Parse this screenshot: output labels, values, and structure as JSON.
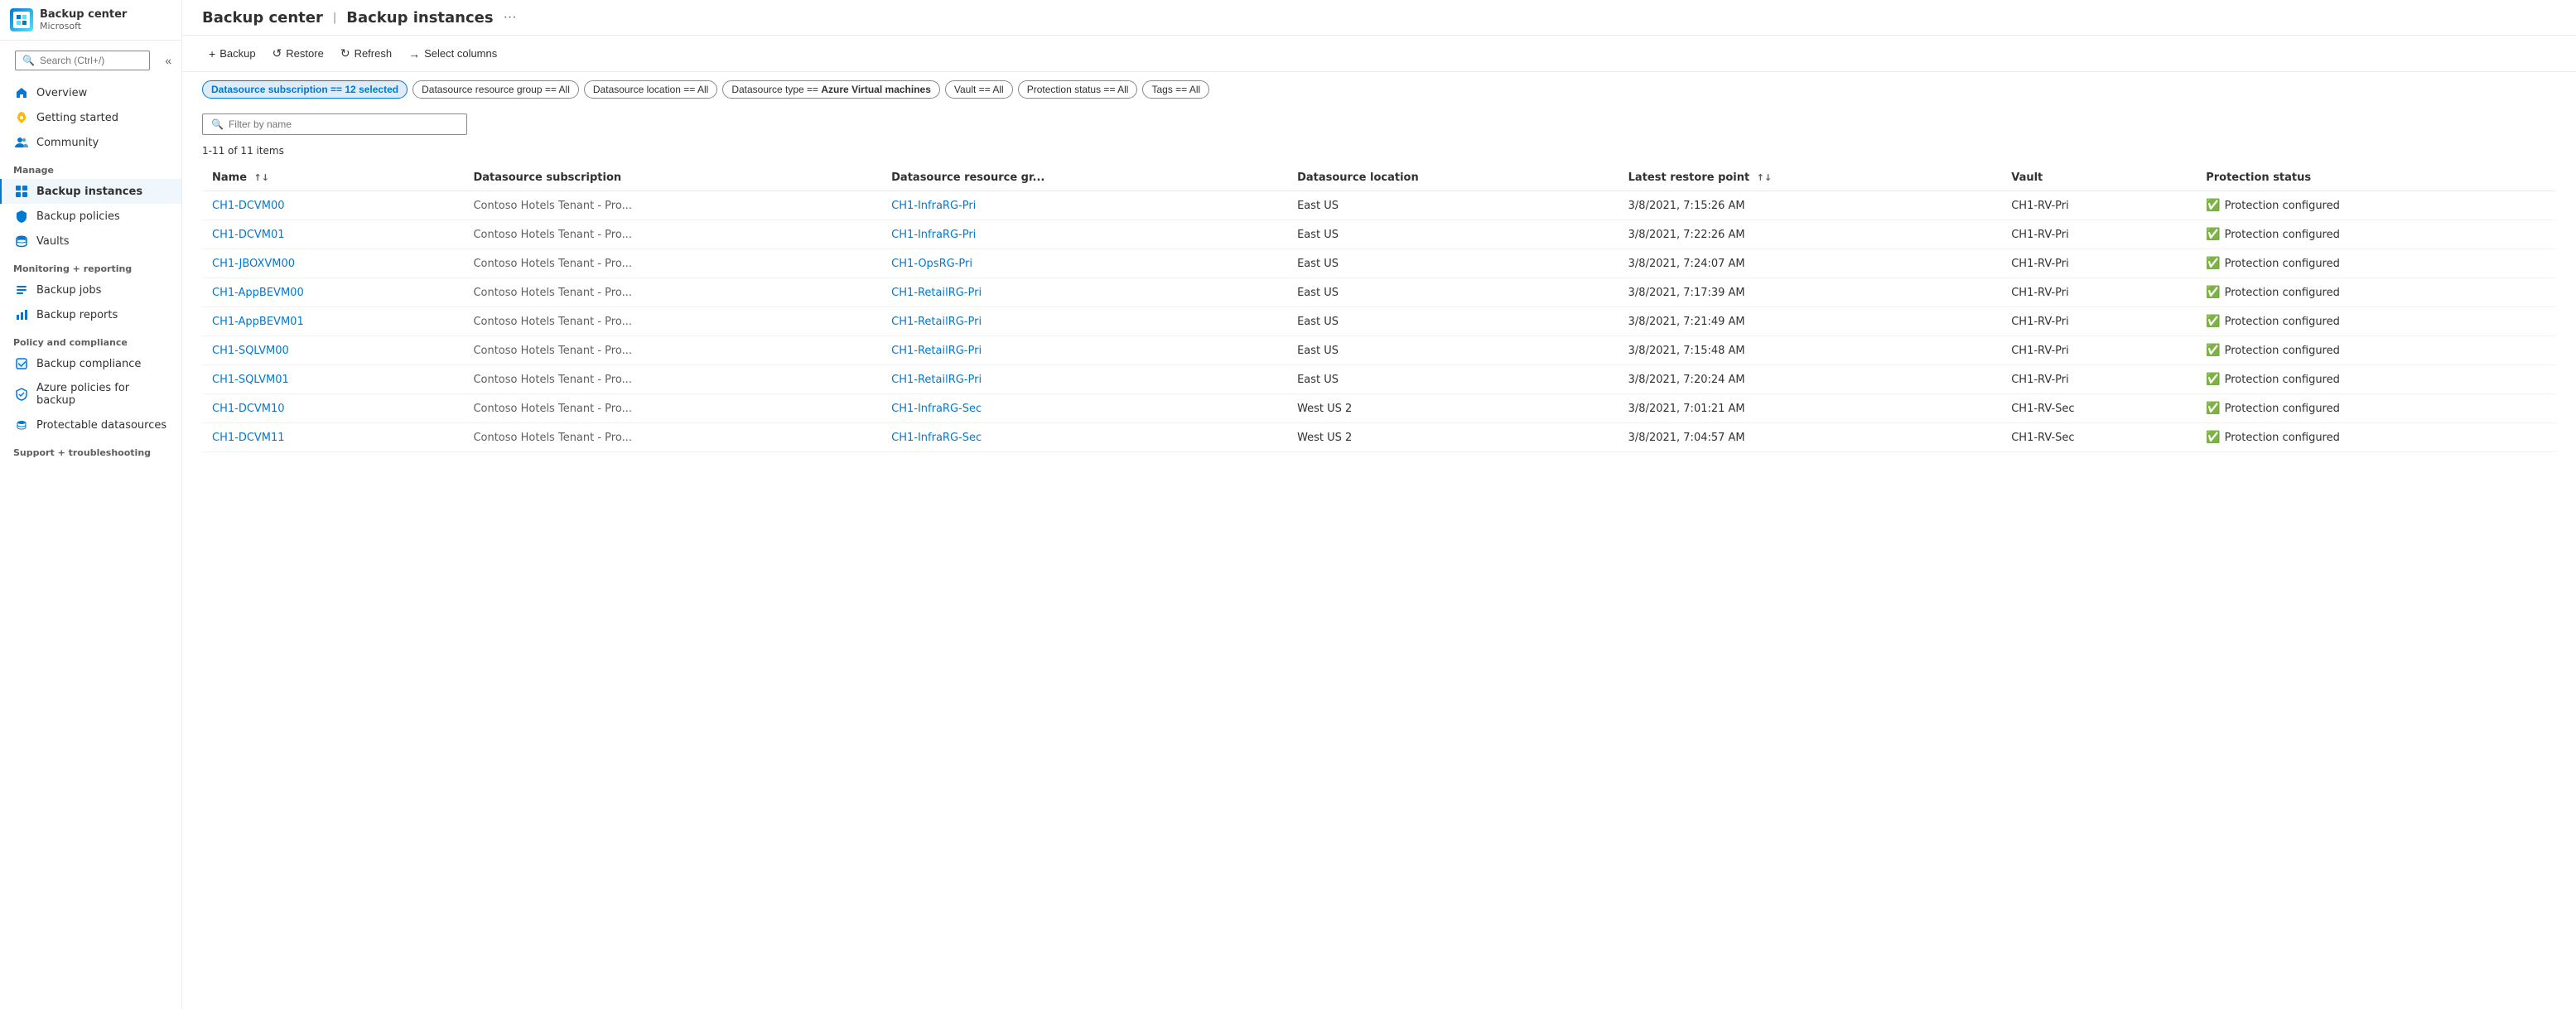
{
  "app": {
    "title": "Backup center",
    "subtitle": "Microsoft",
    "page": "Backup instances"
  },
  "sidebar": {
    "search_placeholder": "Search (Ctrl+/)",
    "nav_items": [
      {
        "id": "overview",
        "label": "Overview",
        "icon": "home"
      },
      {
        "id": "getting-started",
        "label": "Getting started",
        "icon": "rocket"
      },
      {
        "id": "community",
        "label": "Community",
        "icon": "people"
      }
    ],
    "sections": [
      {
        "label": "Manage",
        "items": [
          {
            "id": "backup-instances",
            "label": "Backup instances",
            "icon": "grid",
            "active": true
          },
          {
            "id": "backup-policies",
            "label": "Backup policies",
            "icon": "shield"
          },
          {
            "id": "vaults",
            "label": "Vaults",
            "icon": "database"
          }
        ]
      },
      {
        "label": "Monitoring + reporting",
        "items": [
          {
            "id": "backup-jobs",
            "label": "Backup jobs",
            "icon": "list"
          },
          {
            "id": "backup-reports",
            "label": "Backup reports",
            "icon": "chart"
          }
        ]
      },
      {
        "label": "Policy and compliance",
        "items": [
          {
            "id": "backup-compliance",
            "label": "Backup compliance",
            "icon": "check"
          },
          {
            "id": "azure-policies",
            "label": "Azure policies for backup",
            "icon": "policy"
          },
          {
            "id": "protectable-datasources",
            "label": "Protectable datasources",
            "icon": "data"
          }
        ]
      },
      {
        "label": "Support + troubleshooting",
        "items": []
      }
    ]
  },
  "toolbar": {
    "backup_label": "+ Backup",
    "restore_label": "Restore",
    "refresh_label": "Refresh",
    "select_columns_label": "Select columns"
  },
  "filters": [
    {
      "id": "datasource-sub",
      "label": "Datasource subscription == 12 selected",
      "active": true
    },
    {
      "id": "datasource-rg",
      "label": "Datasource resource group == All",
      "active": false
    },
    {
      "id": "datasource-location",
      "label": "Datasource location == All",
      "active": false
    },
    {
      "id": "datasource-type",
      "label": "Datasource type == Azure Virtual machines",
      "active": false
    },
    {
      "id": "vault",
      "label": "Vault == All",
      "active": false
    },
    {
      "id": "protection-status",
      "label": "Protection status == All",
      "active": false
    },
    {
      "id": "tags",
      "label": "Tags == All",
      "active": false
    }
  ],
  "filter_placeholder": "Filter by name",
  "items_count": "1-11 of 11 items",
  "table": {
    "columns": [
      {
        "id": "name",
        "label": "Name",
        "sortable": true
      },
      {
        "id": "datasource-sub",
        "label": "Datasource subscription",
        "sortable": false
      },
      {
        "id": "datasource-rg",
        "label": "Datasource resource gr...",
        "sortable": false
      },
      {
        "id": "datasource-loc",
        "label": "Datasource location",
        "sortable": false
      },
      {
        "id": "latest-restore",
        "label": "Latest restore point",
        "sortable": true
      },
      {
        "id": "vault",
        "label": "Vault",
        "sortable": false
      },
      {
        "id": "protection-status",
        "label": "Protection status",
        "sortable": false
      }
    ],
    "rows": [
      {
        "name": "CH1-DCVM00",
        "datasource_sub": "Contoso Hotels Tenant - Pro...",
        "datasource_rg": "CH1-InfraRG-Pri",
        "datasource_loc": "East US",
        "latest_restore": "3/8/2021, 7:15:26 AM",
        "vault": "CH1-RV-Pri",
        "protection_status": "Protection configured"
      },
      {
        "name": "CH1-DCVM01",
        "datasource_sub": "Contoso Hotels Tenant - Pro...",
        "datasource_rg": "CH1-InfraRG-Pri",
        "datasource_loc": "East US",
        "latest_restore": "3/8/2021, 7:22:26 AM",
        "vault": "CH1-RV-Pri",
        "protection_status": "Protection configured"
      },
      {
        "name": "CH1-JBOXVM00",
        "datasource_sub": "Contoso Hotels Tenant - Pro...",
        "datasource_rg": "CH1-OpsRG-Pri",
        "datasource_loc": "East US",
        "latest_restore": "3/8/2021, 7:24:07 AM",
        "vault": "CH1-RV-Pri",
        "protection_status": "Protection configured"
      },
      {
        "name": "CH1-AppBEVM00",
        "datasource_sub": "Contoso Hotels Tenant - Pro...",
        "datasource_rg": "CH1-RetailRG-Pri",
        "datasource_loc": "East US",
        "latest_restore": "3/8/2021, 7:17:39 AM",
        "vault": "CH1-RV-Pri",
        "protection_status": "Protection configured"
      },
      {
        "name": "CH1-AppBEVM01",
        "datasource_sub": "Contoso Hotels Tenant - Pro...",
        "datasource_rg": "CH1-RetailRG-Pri",
        "datasource_loc": "East US",
        "latest_restore": "3/8/2021, 7:21:49 AM",
        "vault": "CH1-RV-Pri",
        "protection_status": "Protection configured"
      },
      {
        "name": "CH1-SQLVM00",
        "datasource_sub": "Contoso Hotels Tenant - Pro...",
        "datasource_rg": "CH1-RetailRG-Pri",
        "datasource_loc": "East US",
        "latest_restore": "3/8/2021, 7:15:48 AM",
        "vault": "CH1-RV-Pri",
        "protection_status": "Protection configured"
      },
      {
        "name": "CH1-SQLVM01",
        "datasource_sub": "Contoso Hotels Tenant - Pro...",
        "datasource_rg": "CH1-RetailRG-Pri",
        "datasource_loc": "East US",
        "latest_restore": "3/8/2021, 7:20:24 AM",
        "vault": "CH1-RV-Pri",
        "protection_status": "Protection configured"
      },
      {
        "name": "CH1-DCVM10",
        "datasource_sub": "Contoso Hotels Tenant - Pro...",
        "datasource_rg": "CH1-InfraRG-Sec",
        "datasource_loc": "West US 2",
        "latest_restore": "3/8/2021, 7:01:21 AM",
        "vault": "CH1-RV-Sec",
        "protection_status": "Protection configured"
      },
      {
        "name": "CH1-DCVM11",
        "datasource_sub": "Contoso Hotels Tenant - Pro...",
        "datasource_rg": "CH1-InfraRG-Sec",
        "datasource_loc": "West US 2",
        "latest_restore": "3/8/2021, 7:04:57 AM",
        "vault": "CH1-RV-Sec",
        "protection_status": "Protection configured"
      }
    ]
  }
}
